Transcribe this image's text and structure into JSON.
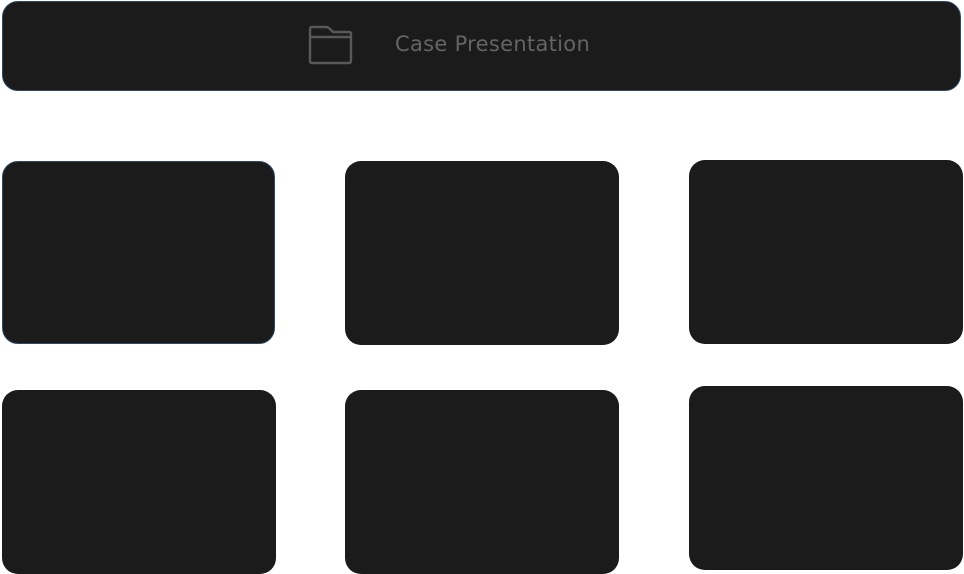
{
  "header": {
    "icon": "folder-icon",
    "label": "Case Presentation"
  },
  "colors": {
    "panel": "#1b1b1b",
    "selected_border": "#2c4a66",
    "muted_text": "#646464",
    "icon_stroke": "#585858"
  },
  "tiles": [
    {
      "selected": true
    },
    {
      "selected": false
    },
    {
      "selected": false
    },
    {
      "selected": false
    },
    {
      "selected": false
    },
    {
      "selected": false
    }
  ]
}
